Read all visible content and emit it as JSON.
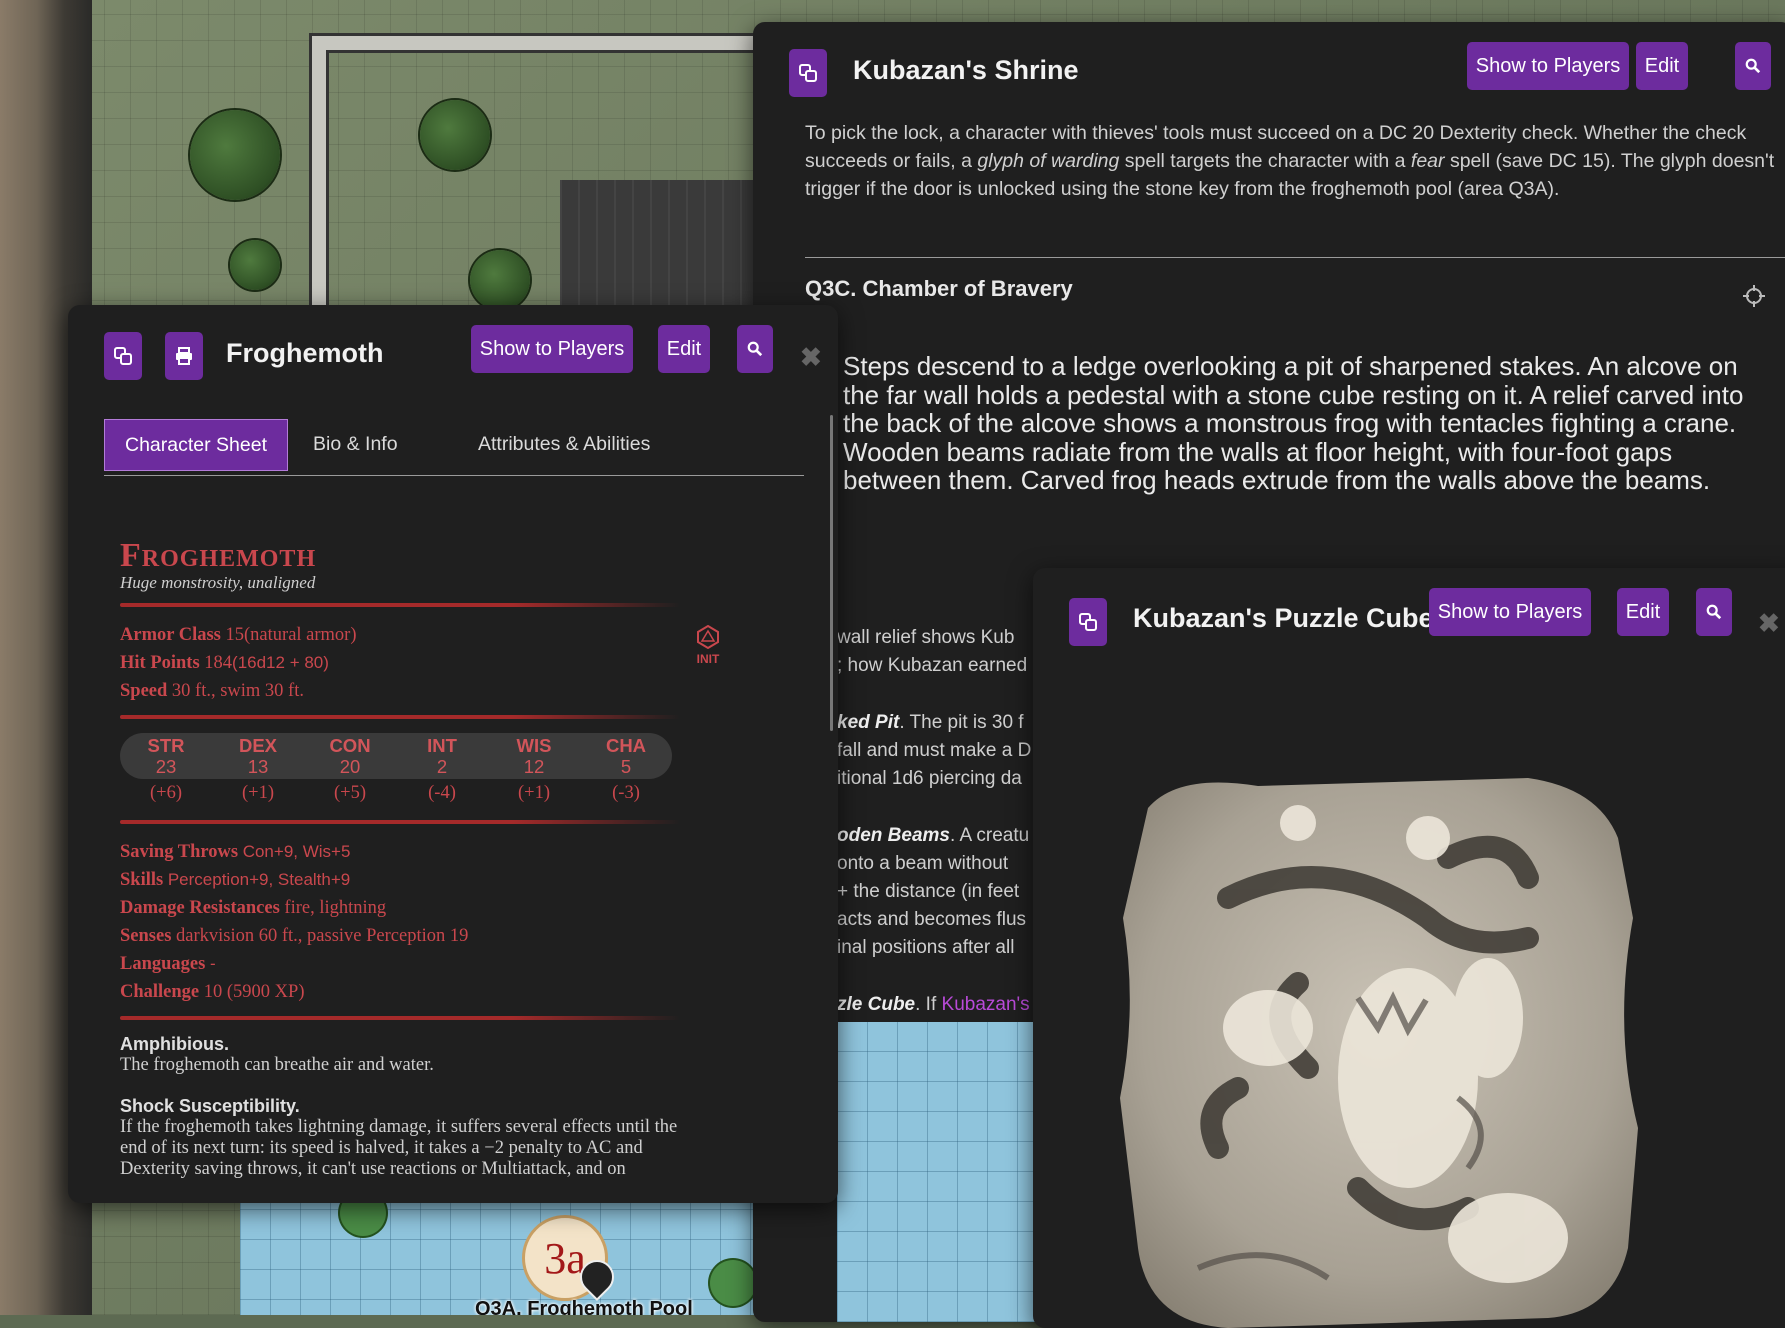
{
  "map": {
    "marker_text": "3a",
    "location_label": "Q3A. Froghemoth Pool"
  },
  "shrine": {
    "title": "Kubazan's Shrine",
    "show_label": "Show to Players",
    "edit_label": "Edit",
    "para1_a": "To pick the lock, a character with thieves' tools must succeed on a DC 20 Dexterity check. Whether the check succeeds or fails, a ",
    "para1_b": "glyph of warding",
    "para1_c": " spell targets the character with a ",
    "para1_d": "fear",
    "para1_e": " spell (save DC 15). The glyph doesn't trigger if the door is unlocked using the stone key from the froghemoth pool (area Q3A).",
    "section_title": "Q3C. Chamber of Bravery",
    "boxed_text": "Steps descend to a ledge overlooking a pit of sharpened stakes. An alcove on the far wall holds a pedestal with a stone cube resting on it. A relief carved into the back of the alcove shows a monstrous frog with tentacles fighting a crane. Wooden beams radiate from the walls at floor height, with four-foot gaps between them. Carved frog heads extrude from the walls above the beams.",
    "partial_lines": [
      {
        "text": " wall relief shows Kub",
        "bold": ""
      },
      {
        "text": "; how Kubazan earned",
        "bold": ""
      },
      {
        "text": ". The pit is 30 f",
        "bold": "ked Pit"
      },
      {
        "text": " fall and must make a D",
        "bold": ""
      },
      {
        "text": "itional 1d6 piercing da",
        "bold": ""
      },
      {
        "text": ". A creatu",
        "bold": "oden Beams"
      },
      {
        "text": " onto a beam without",
        "bold": ""
      },
      {
        "text": "+ the distance (in feet",
        "bold": ""
      },
      {
        "text": "acts and becomes flus",
        "bold": ""
      },
      {
        "text": "inal positions after all",
        "bold": ""
      },
      {
        "text": ". If ",
        "bold": "zle Cube",
        "link": "Kubazan's"
      }
    ]
  },
  "froghemoth": {
    "title": "Froghemoth",
    "show_label": "Show to Players",
    "edit_label": "Edit",
    "tabs": [
      "Character Sheet",
      "Bio & Info",
      "Attributes & Abilities"
    ],
    "name": "Froghemoth",
    "subtitle": "Huge monstrosity, unaligned",
    "armor_class_label": "Armor Class",
    "armor_class_value": "15",
    "armor_class_note": "(natural armor)",
    "hit_points_label": "Hit Points",
    "hit_points_value": "184",
    "hit_points_dice": "(16d12 + 80)",
    "speed_label": "Speed",
    "speed_value": "30 ft., swim 30 ft.",
    "init_label": "INIT",
    "stats": [
      {
        "name": "STR",
        "score": "23",
        "mod": "(+6)"
      },
      {
        "name": "DEX",
        "score": "13",
        "mod": "(+1)"
      },
      {
        "name": "CON",
        "score": "20",
        "mod": "(+5)"
      },
      {
        "name": "INT",
        "score": "2",
        "mod": "(-4)"
      },
      {
        "name": "WIS",
        "score": "12",
        "mod": "(+1)"
      },
      {
        "name": "CHA",
        "score": "5",
        "mod": "(-3)"
      }
    ],
    "saving_throws_label": "Saving Throws",
    "saving_throws_value": "Con+9, Wis+5",
    "skills_label": "Skills",
    "skills_value": "Perception+9, Stealth+9",
    "damage_res_label": "Damage Resistances",
    "damage_res_value": "fire, lightning",
    "senses_label": "Senses",
    "senses_value": "darkvision 60 ft., passive Perception 19",
    "languages_label": "Languages",
    "languages_value": "-",
    "challenge_label": "Challenge",
    "challenge_value": "10 (5900 XP)",
    "traits": [
      {
        "name": "Amphibious.",
        "text": "The froghemoth can breathe air and water."
      },
      {
        "name": "Shock Susceptibility.",
        "text": "If the froghemoth takes lightning damage, it suffers several effects until the end of its next turn: its speed is halved, it takes a −2 penalty to AC and Dexterity saving throws, it can't use reactions or Multiattack, and on"
      }
    ]
  },
  "cube": {
    "title": "Kubazan's Puzzle Cube",
    "show_label": "Show to Players",
    "edit_label": "Edit"
  },
  "colors": {
    "accent": "#6d2c9e",
    "statblock_red": "#c9474d",
    "panel_bg": "#1f1f1f"
  }
}
